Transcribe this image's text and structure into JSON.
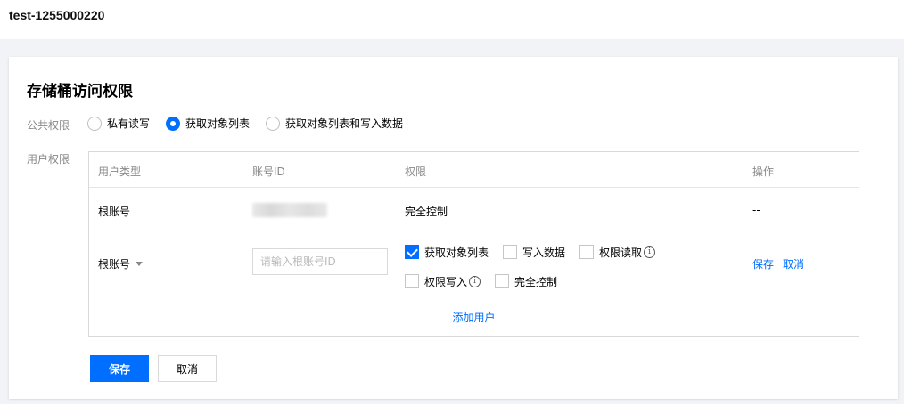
{
  "header": {
    "bucket_name": "test-1255000220"
  },
  "card": {
    "title": "存储桶访问权限",
    "public_label": "公共权限",
    "user_label": "用户权限",
    "public_options": [
      {
        "label": "私有读写",
        "checked": false
      },
      {
        "label": "获取对象列表",
        "checked": true
      },
      {
        "label": "获取对象列表和写入数据",
        "checked": false
      }
    ]
  },
  "table": {
    "headers": [
      "用户类型",
      "账号ID",
      "权限",
      "操作"
    ],
    "row1": {
      "user_type": "根账号",
      "account_id": "",
      "permission": "完全控制",
      "action": "--"
    },
    "row2": {
      "user_type": "根账号",
      "input_placeholder": "请输入根账号ID",
      "permissions_line1": [
        {
          "label": "获取对象列表",
          "checked": true,
          "info": false
        },
        {
          "label": "写入数据",
          "checked": false,
          "info": false
        },
        {
          "label": "权限读取",
          "checked": false,
          "info": true
        }
      ],
      "permissions_line2": [
        {
          "label": "权限写入",
          "checked": false,
          "info": true
        },
        {
          "label": "完全控制",
          "checked": false,
          "info": false
        }
      ],
      "save_label": "保存",
      "cancel_label": "取消"
    },
    "add_user_label": "添加用户"
  },
  "footer": {
    "save_label": "保存",
    "cancel_label": "取消"
  },
  "colors": {
    "accent": "#006eff",
    "muted_text": "#888888"
  }
}
